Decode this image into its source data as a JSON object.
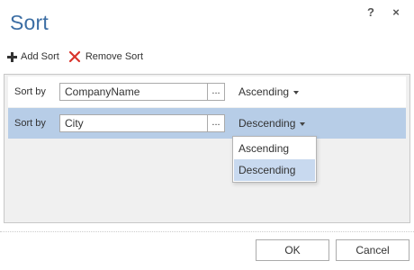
{
  "dialog": {
    "title": "Sort",
    "help_label": "?",
    "close_label": "×"
  },
  "toolbar": {
    "add_label": "Add Sort",
    "remove_label": "Remove Sort"
  },
  "sort_rows": [
    {
      "label": "Sort by",
      "field": "CompanyName",
      "ellipsis": "...",
      "order": "Ascending"
    },
    {
      "label": "Sort by",
      "field": "City",
      "ellipsis": "...",
      "order": "Descending"
    }
  ],
  "dropdown": {
    "options": [
      "Ascending",
      "Descending"
    ],
    "selected": "Descending"
  },
  "footer": {
    "ok_label": "OK",
    "cancel_label": "Cancel"
  },
  "colors": {
    "title": "#3c6ea4",
    "selected_row": "#b7cde7",
    "remove_icon": "#d9342b"
  }
}
